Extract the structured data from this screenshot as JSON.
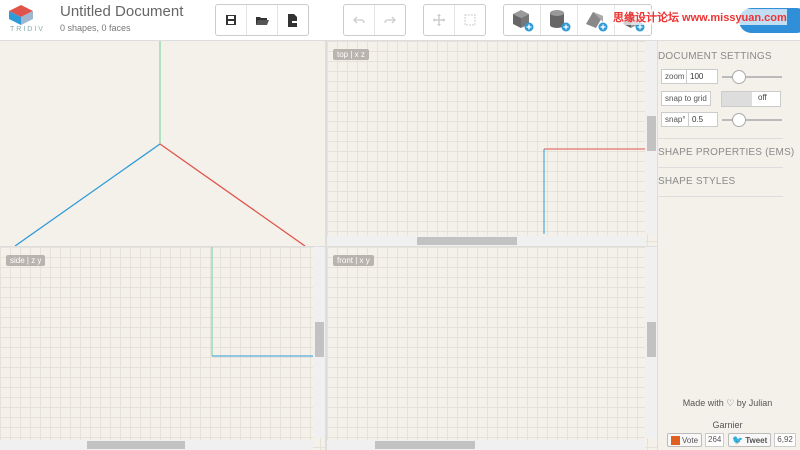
{
  "header": {
    "logo_text": "TRIDIV",
    "doc_title": "Untitled Document",
    "doc_sub": "0 shapes, 0 faces",
    "cta_label": "",
    "watermark": "思缘设计论坛 www.missyuan.com"
  },
  "toolbar": {
    "file": [
      "save-icon",
      "open-folder-icon",
      "export-icon"
    ],
    "history": [
      "undo-icon",
      "redo-icon"
    ],
    "tools": [
      "move-icon",
      "select-icon"
    ],
    "shapes": [
      "add-cube-icon",
      "add-cylinder-icon",
      "add-prism-icon",
      "add-pyramid-icon"
    ]
  },
  "viewports": {
    "top_label": "top | x z",
    "side_label": "side | z y",
    "front_label": "front | x y"
  },
  "colors": {
    "axis_x": "#e0544c",
    "axis_y": "#6ecf9a",
    "axis_z": "#2f9ad8",
    "grid_bg": "#f4f1ea"
  },
  "sidebar": {
    "document_settings": "DOCUMENT SETTINGS",
    "zoom_label": "zoom",
    "zoom_value": "100",
    "snap_grid_label": "snap to grid",
    "snap_grid_value": "off",
    "snap_label": "snap°",
    "snap_value": "0.5",
    "shape_properties": "SHAPE PROPERTIES (ems)",
    "shape_styles": "SHAPE STYLES",
    "made_with": "Made with ♡ by Julian Garnier",
    "vote_label": "Vote",
    "vote_count": "264",
    "tweet_label": "Tweet",
    "tweet_count": "6,92"
  }
}
